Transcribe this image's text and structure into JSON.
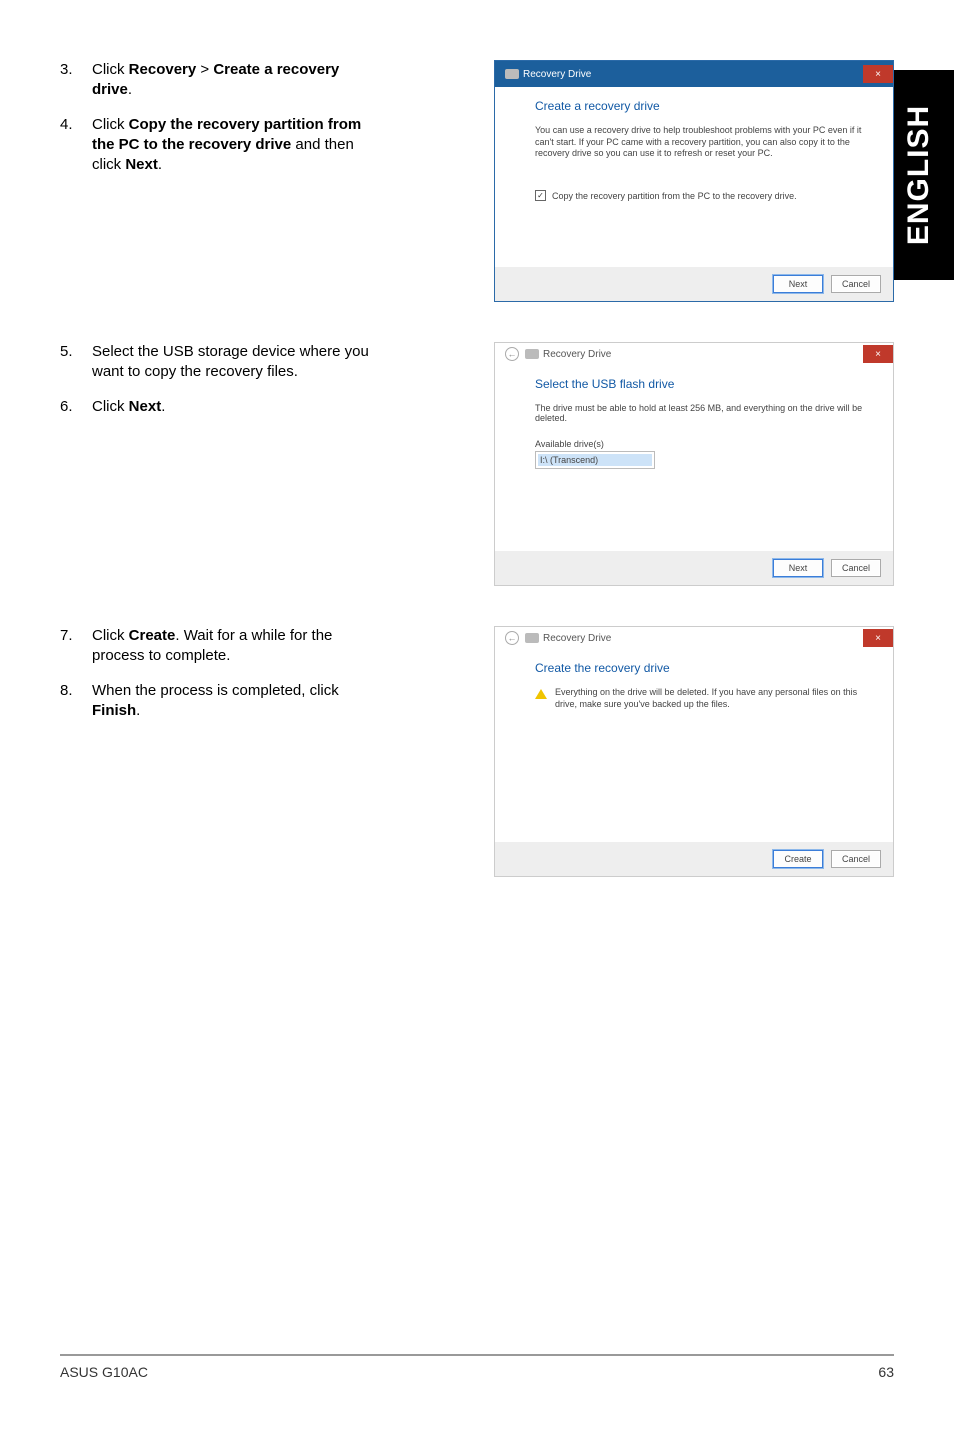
{
  "side_tab": "ENGLISH",
  "footer": {
    "product": "ASUS G10AC",
    "page_num": "63"
  },
  "steps": {
    "s3_num": "3.",
    "s3_a": "Click ",
    "s3_b1": "Recovery",
    "s3_c": " > ",
    "s3_b2": "Create a recovery drive",
    "s3_d": ".",
    "s4_num": "4.",
    "s4_a": "Click ",
    "s4_b1": "Copy the recovery partition from the PC to the recovery drive",
    "s4_c": " and then click ",
    "s4_b2": "Next",
    "s4_d": ".",
    "s5_num": "5.",
    "s5_a": "Select the USB storage device where you want to copy the recovery files.",
    "s6_num": "6.",
    "s6_a": "Click ",
    "s6_b1": "Next",
    "s6_d": ".",
    "s7_num": "7.",
    "s7_a": "Click ",
    "s7_b1": "Create",
    "s7_c": ". Wait for a while for the process to complete.",
    "s8_num": "8.",
    "s8_a": "When the process is completed, click ",
    "s8_b1": "Finish",
    "s8_d": "."
  },
  "dlg1": {
    "title": "Recovery Drive",
    "close": "×",
    "heading": "Create a recovery drive",
    "body": "You can use a recovery drive to help troubleshoot problems with your PC even if it can't start. If your PC came with a recovery partition, you can also copy it to the recovery drive so you can use it to refresh or reset your PC.",
    "cb_checked": "✓",
    "cb_label": "Copy the recovery partition from the PC to the recovery drive.",
    "btn_next": "Next",
    "btn_cancel": "Cancel"
  },
  "dlg2": {
    "title": "Recovery Drive",
    "close": "×",
    "back": "←",
    "heading": "Select the USB flash drive",
    "body": "The drive must be able to hold at least 256 MB, and everything on the drive will be deleted.",
    "list_label": "Available drive(s)",
    "list_item": "I:\\ (Transcend)",
    "btn_next": "Next",
    "btn_cancel": "Cancel"
  },
  "dlg3": {
    "title": "Recovery Drive",
    "close": "×",
    "back": "←",
    "heading": "Create the recovery drive",
    "warn": "Everything on the drive will be deleted. If you have any personal files on this drive, make sure you've backed up the files.",
    "btn_create": "Create",
    "btn_cancel": "Cancel"
  }
}
